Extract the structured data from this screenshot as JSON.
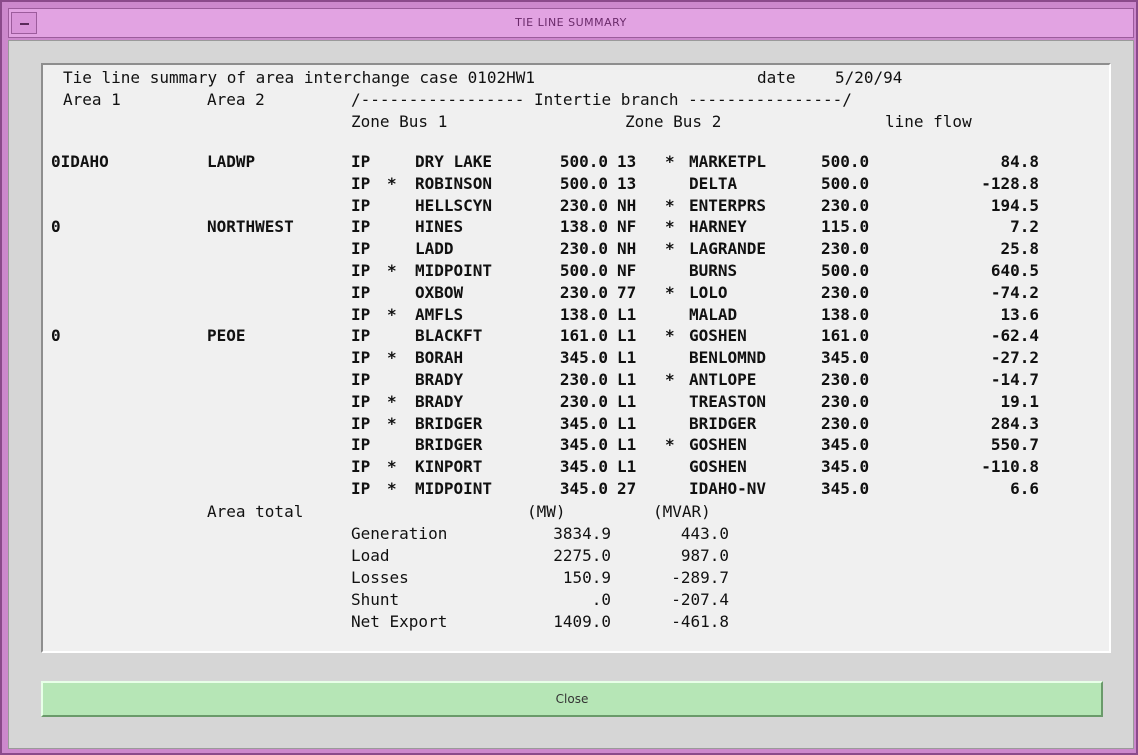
{
  "window": {
    "title": "TIE LINE SUMMARY"
  },
  "header": {
    "line1": "Tie line summary of area interchange case 0102HW1",
    "date_label": "date",
    "date_value": "5/20/94",
    "area1": "Area 1",
    "area2": "Area 2",
    "intertie": "/----------------- Intertie branch ----------------/",
    "zone_bus1": "Zone Bus 1",
    "zone_bus2": "Zone Bus 2",
    "line_flow": "line flow"
  },
  "rows": [
    {
      "area1": "0IDAHO",
      "area2": "LADWP",
      "z1": "IP",
      "m1": "",
      "bus1": "DRY LAKE",
      "kv1": "500.0",
      "z2": "13",
      "m2": "*",
      "bus2": "MARKETPL",
      "kv2": "500.0",
      "flow": "84.8"
    },
    {
      "area1": "",
      "area2": "",
      "z1": "IP",
      "m1": "*",
      "bus1": "ROBINSON",
      "kv1": "500.0",
      "z2": "13",
      "m2": "",
      "bus2": "DELTA",
      "kv2": "500.0",
      "flow": "-128.8"
    },
    {
      "area1": "",
      "area2": "",
      "z1": "IP",
      "m1": "",
      "bus1": "HELLSCYN",
      "kv1": "230.0",
      "z2": "NH",
      "m2": "*",
      "bus2": "ENTERPRS",
      "kv2": "230.0",
      "flow": "194.5"
    },
    {
      "area1": "0",
      "area2": "NORTHWEST",
      "z1": "IP",
      "m1": "",
      "bus1": "HINES",
      "kv1": "138.0",
      "z2": "NF",
      "m2": "*",
      "bus2": "HARNEY",
      "kv2": "115.0",
      "flow": "7.2"
    },
    {
      "area1": "",
      "area2": "",
      "z1": "IP",
      "m1": "",
      "bus1": "LADD",
      "kv1": "230.0",
      "z2": "NH",
      "m2": "*",
      "bus2": "LAGRANDE",
      "kv2": "230.0",
      "flow": "25.8"
    },
    {
      "area1": "",
      "area2": "",
      "z1": "IP",
      "m1": "*",
      "bus1": "MIDPOINT",
      "kv1": "500.0",
      "z2": "NF",
      "m2": "",
      "bus2": "BURNS",
      "kv2": "500.0",
      "flow": "640.5"
    },
    {
      "area1": "",
      "area2": "",
      "z1": "IP",
      "m1": "",
      "bus1": "OXBOW",
      "kv1": "230.0",
      "z2": "77",
      "m2": "*",
      "bus2": "LOLO",
      "kv2": "230.0",
      "flow": "-74.2"
    },
    {
      "area1": "",
      "area2": "",
      "z1": "IP",
      "m1": "*",
      "bus1": "AMFLS",
      "kv1": "138.0",
      "z2": "L1",
      "m2": "",
      "bus2": "MALAD",
      "kv2": "138.0",
      "flow": "13.6"
    },
    {
      "area1": "0",
      "area2": "PEOE",
      "z1": "IP",
      "m1": "",
      "bus1": "BLACKFT",
      "kv1": "161.0",
      "z2": "L1",
      "m2": "*",
      "bus2": "GOSHEN",
      "kv2": "161.0",
      "flow": "-62.4"
    },
    {
      "area1": "",
      "area2": "",
      "z1": "IP",
      "m1": "*",
      "bus1": "BORAH",
      "kv1": "345.0",
      "z2": "L1",
      "m2": "",
      "bus2": "BENLOMND",
      "kv2": "345.0",
      "flow": "-27.2"
    },
    {
      "area1": "",
      "area2": "",
      "z1": "IP",
      "m1": "",
      "bus1": "BRADY",
      "kv1": "230.0",
      "z2": "L1",
      "m2": "*",
      "bus2": "ANTLOPE",
      "kv2": "230.0",
      "flow": "-14.7"
    },
    {
      "area1": "",
      "area2": "",
      "z1": "IP",
      "m1": "*",
      "bus1": "BRADY",
      "kv1": "230.0",
      "z2": "L1",
      "m2": "",
      "bus2": "TREASTON",
      "kv2": "230.0",
      "flow": "19.1"
    },
    {
      "area1": "",
      "area2": "",
      "z1": "IP",
      "m1": "*",
      "bus1": "BRIDGER",
      "kv1": "345.0",
      "z2": "L1",
      "m2": "",
      "bus2": "BRIDGER",
      "kv2": "230.0",
      "flow": "284.3"
    },
    {
      "area1": "",
      "area2": "",
      "z1": "IP",
      "m1": "",
      "bus1": "BRIDGER",
      "kv1": "345.0",
      "z2": "L1",
      "m2": "*",
      "bus2": "GOSHEN",
      "kv2": "345.0",
      "flow": "550.7"
    },
    {
      "area1": "",
      "area2": "",
      "z1": "IP",
      "m1": "*",
      "bus1": "KINPORT",
      "kv1": "345.0",
      "z2": "L1",
      "m2": "",
      "bus2": "GOSHEN",
      "kv2": "345.0",
      "flow": "-110.8"
    },
    {
      "area1": "",
      "area2": "",
      "z1": "IP",
      "m1": "*",
      "bus1": "MIDPOINT",
      "kv1": "345.0",
      "z2": "27",
      "m2": "",
      "bus2": "IDAHO-NV",
      "kv2": "345.0",
      "flow": "6.6"
    }
  ],
  "totals": {
    "label": "Area total",
    "mw_header": "(MW)",
    "mvar_header": "(MVAR)",
    "items": [
      {
        "name": "Generation",
        "mw": "3834.9",
        "mvar": "443.0"
      },
      {
        "name": "Load",
        "mw": "2275.0",
        "mvar": "987.0"
      },
      {
        "name": "Losses",
        "mw": "150.9",
        "mvar": "-289.7"
      },
      {
        "name": "Shunt",
        "mw": ".0",
        "mvar": "-207.4"
      },
      {
        "name": "Net Export",
        "mw": "1409.0",
        "mvar": "-461.8"
      }
    ]
  },
  "buttons": {
    "close": "Close"
  },
  "colors": {
    "title_bg": "#e2a3e2",
    "frame": "#cc88cc",
    "close_bg": "#b6e6b6"
  }
}
